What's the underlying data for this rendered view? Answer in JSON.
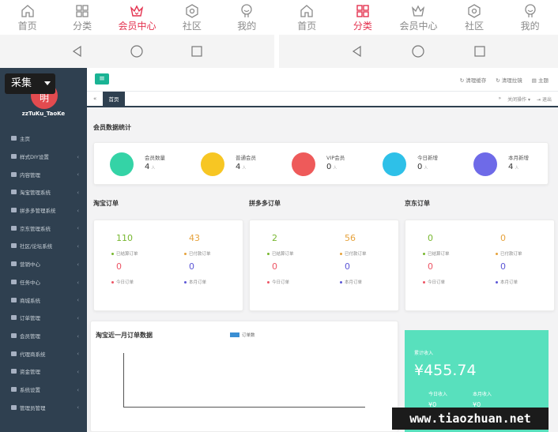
{
  "phone_left": {
    "tabs": [
      {
        "label": "首页",
        "icon": "home-icon"
      },
      {
        "label": "分类",
        "icon": "grid-icon"
      },
      {
        "label": "会员中心",
        "icon": "crown-icon",
        "active": true
      },
      {
        "label": "社区",
        "icon": "hexagon-icon"
      },
      {
        "label": "我的",
        "icon": "user-icon"
      }
    ]
  },
  "phone_right": {
    "tabs": [
      {
        "label": "首页",
        "icon": "home-icon"
      },
      {
        "label": "分类",
        "icon": "grid-icon",
        "active": true
      },
      {
        "label": "会员中心",
        "icon": "crown-icon"
      },
      {
        "label": "社区",
        "icon": "hexagon-icon"
      },
      {
        "label": "我的",
        "icon": "user-icon"
      }
    ]
  },
  "overlay": {
    "collect_label": "采集"
  },
  "sidebar": {
    "avatar_text": "明",
    "username": "zzTuKu_TaoKe",
    "items": [
      "主页",
      "样式DIY设置",
      "内容管理",
      "淘宝管理系统",
      "拼多多管理系统",
      "京东管理系统",
      "社区/论坛系统",
      "营销中心",
      "任务中心",
      "商城系统",
      "订单管理",
      "会员管理",
      "代理商系统",
      "资金管理",
      "系统设置",
      "管理员管理"
    ]
  },
  "topbar": {
    "clear_cache": "清理缓存",
    "clear_pull": "清理拉镜",
    "theme": "主题"
  },
  "tabs": {
    "home": "首页",
    "close_ops": "关闭操作",
    "logout": "退出"
  },
  "member_stats": {
    "title": "会员数据统计",
    "unit": "人",
    "items": [
      {
        "label": "会员数量",
        "value": "4",
        "color": "#34d3a6"
      },
      {
        "label": "普通会员",
        "value": "4",
        "color": "#f7c623"
      },
      {
        "label": "VIP会员",
        "value": "0",
        "color": "#ee5a5a"
      },
      {
        "label": "今日新增",
        "value": "0",
        "color": "#2ec0e8"
      },
      {
        "label": "本月新增",
        "value": "4",
        "color": "#6e6ae8"
      }
    ]
  },
  "orders": [
    {
      "title": "淘宝订单",
      "settled": "110",
      "paid": "43",
      "today": "0",
      "month": "0"
    },
    {
      "title": "拼多多订单",
      "settled": "2",
      "paid": "56",
      "today": "0",
      "month": "0"
    },
    {
      "title": "京东订单",
      "settled": "0",
      "paid": "0",
      "today": "0",
      "month": "0"
    }
  ],
  "order_labels": {
    "settled": "已结算订单",
    "paid": "已付款订单",
    "today": "今日订单",
    "month": "本月订单"
  },
  "chart": {
    "title": "淘宝近一月订单数据",
    "legend": "订单数"
  },
  "income": {
    "label": "累计收入",
    "value": "¥455.74",
    "today": "今日收入",
    "month": "本月收入",
    "today_value": "¥0",
    "month_value": "¥0"
  },
  "watermark": "www.tiaozhuan.net"
}
